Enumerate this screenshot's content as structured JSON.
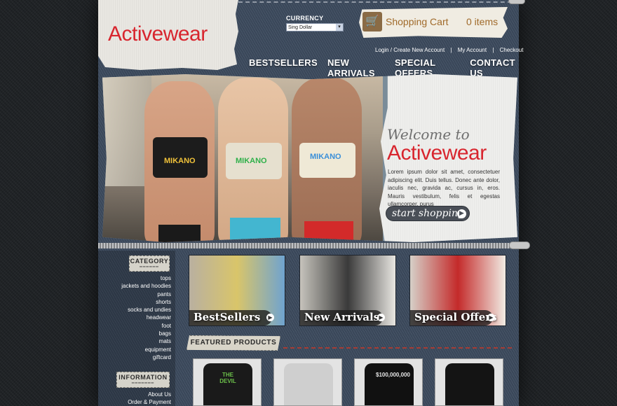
{
  "brand": {
    "logo_text": "Activewear"
  },
  "currency": {
    "label": "CURRENCY",
    "selected": "Sing Dollar"
  },
  "cart": {
    "title": "Shopping Cart",
    "count": "0 items"
  },
  "account_links": [
    "Login / Create New Account",
    "|",
    "My Account",
    "|",
    "Checkout"
  ],
  "nav": [
    "BESTSELLERS",
    "NEW ARRIVALS",
    "SPECIAL OFFERS",
    "CONTACT US"
  ],
  "hero": {
    "welcome_script": "Welcome to",
    "welcome_brand": "Activewear",
    "body": "Lorem ipsum dolor sit amet, consectetuer adipiscing elit. Duis tellus. Donec ante dolor, iaculis nec, gravida ac, cursus in, eros. Mauris vestibulum, felis et egestas ullamcorper, purus",
    "cta": "start shopping",
    "shirt_logo": "MIKANO"
  },
  "sidebar": {
    "category_label": "CATEGORY",
    "categories": [
      "tops",
      "jackets and hoodies",
      "pants",
      "shorts",
      "socks and undies",
      "headwear",
      "foot",
      "bags",
      "mats",
      "equipment",
      "giftcard"
    ],
    "information_label": "INFORMATION",
    "information": [
      "About Us",
      "Order & Payment"
    ]
  },
  "promos": [
    {
      "title": "BestSellers",
      "colors": [
        "#b9b0a0",
        "#d9c56a",
        "#6fa3cf"
      ]
    },
    {
      "title": "New Arrivals",
      "colors": [
        "#c6c3bc",
        "#3a3a3a",
        "#e8e6e1"
      ]
    },
    {
      "title": "Special Offers",
      "colors": [
        "#d6d0c8",
        "#c42a2a",
        "#f1ece4"
      ]
    }
  ],
  "featured": {
    "label": "FEATURED PRODUCTS",
    "products": [
      {
        "print": "THE DEVIL",
        "shirt": "#1a1a1a",
        "ink": "#6cc04a"
      },
      {
        "print": "",
        "shirt": "#cfcfcf",
        "ink": "#8a8a8a"
      },
      {
        "print": "$100,000,000",
        "shirt": "#111111",
        "ink": "#e6e6e6"
      },
      {
        "print": "",
        "shirt": "#141414",
        "ink": "#d5b7e6"
      }
    ]
  }
}
